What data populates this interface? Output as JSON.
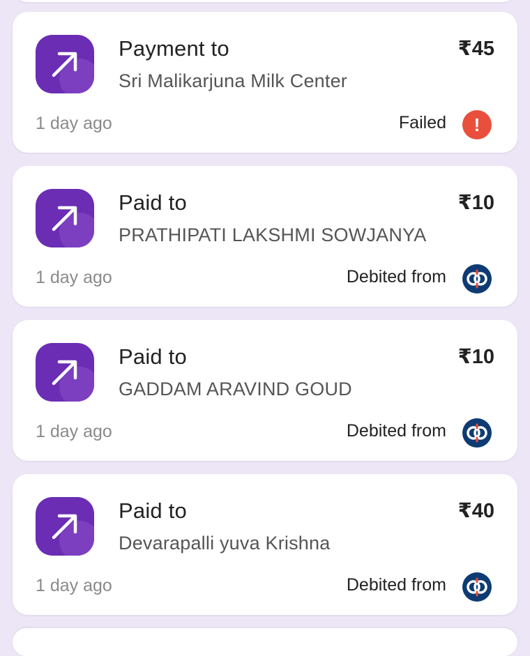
{
  "transactions": [
    {
      "title": "Payment to",
      "name": "Sri Malikarjuna Milk Center",
      "amount": "₹45",
      "time": "1 day ago",
      "status": "Failed",
      "status_icon": "failed-alert-icon",
      "status_color": "#E8503D"
    },
    {
      "title": "Paid to",
      "name": "PRATHIPATI LAKSHMI SOWJANYA",
      "amount": "₹10",
      "time": "1 day ago",
      "status": "Debited from",
      "status_icon": "bank-logo-icon",
      "status_color": "#0E3B73"
    },
    {
      "title": "Paid to",
      "name": "GADDAM ARAVIND GOUD",
      "amount": "₹10",
      "time": "1 day ago",
      "status": "Debited from",
      "status_icon": "bank-logo-icon",
      "status_color": "#0E3B73"
    },
    {
      "title": "Paid to",
      "name": "Devarapalli yuva Krishna",
      "amount": "₹40",
      "time": "1 day ago",
      "status": "Debited from",
      "status_icon": "bank-logo-icon",
      "status_color": "#0E3B73"
    }
  ],
  "colors": {
    "background": "#EDE6F7",
    "icon_purple": "#6A2DB3",
    "failed_red": "#E8503D",
    "bank_blue": "#0E3B73"
  }
}
